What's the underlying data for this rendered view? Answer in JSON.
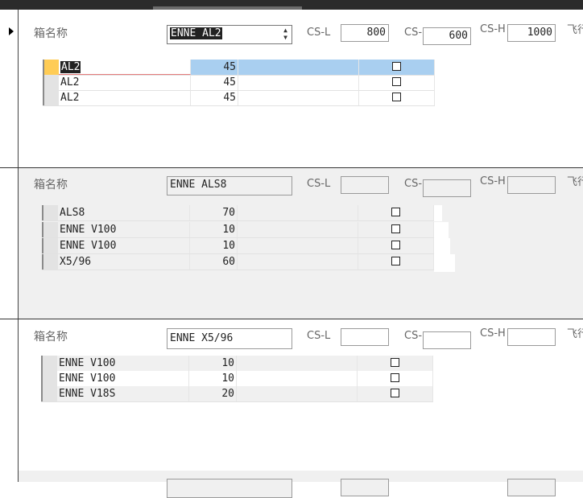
{
  "labels": {
    "box_name": "箱名称",
    "cs_l": "CS-L",
    "cs_w": "CS-",
    "cs_h": "CS-H",
    "flight": "飞行"
  },
  "records": [
    {
      "box_name": "ENNE AL2",
      "cs_l": "800",
      "cs_w": "600",
      "cs_h": "1000",
      "rows": [
        {
          "name": "AL2",
          "qty": "45",
          "checked": false
        },
        {
          "name": "AL2",
          "qty": "45",
          "checked": false
        },
        {
          "name": "AL2",
          "qty": "45",
          "checked": false
        }
      ]
    },
    {
      "box_name": "ENNE ALS8",
      "cs_l": "",
      "cs_w": "",
      "cs_h": "",
      "rows": [
        {
          "name": "ALS8",
          "qty": "70",
          "checked": false
        },
        {
          "name": "ENNE V100",
          "qty": "10",
          "checked": false
        },
        {
          "name": "ENNE V100",
          "qty": "10",
          "checked": false
        },
        {
          "name": "X5/96",
          "qty": "60",
          "checked": false
        }
      ]
    },
    {
      "box_name": "ENNE X5/96",
      "cs_l": "",
      "cs_w": "",
      "cs_h": "",
      "rows": [
        {
          "name": "ENNE V100",
          "qty": "10",
          "checked": false
        },
        {
          "name": "ENNE V100",
          "qty": "10",
          "checked": false
        },
        {
          "name": "ENNE V18S",
          "qty": "20",
          "checked": false
        }
      ]
    }
  ]
}
